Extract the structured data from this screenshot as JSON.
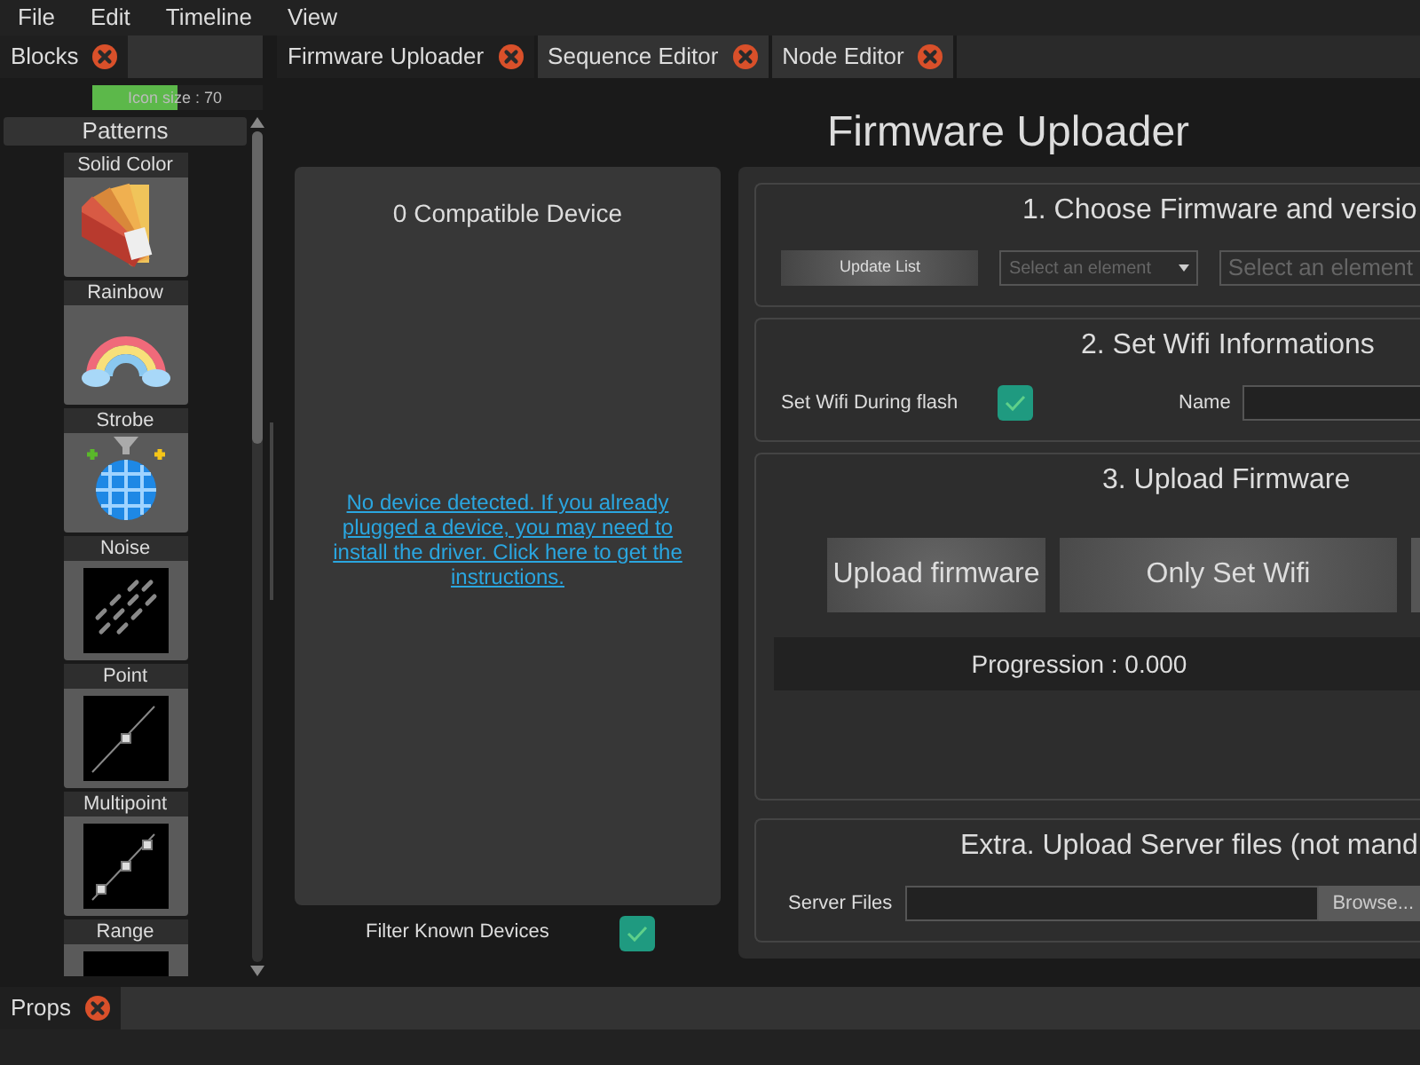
{
  "menu": [
    {
      "label": "File"
    },
    {
      "label": "Edit"
    },
    {
      "label": "Timeline"
    },
    {
      "label": "View"
    }
  ],
  "left_panel": {
    "tab": {
      "label": "Blocks",
      "selected": true
    },
    "icon_size": {
      "label": "Icon size : 70",
      "level": 0.5
    },
    "section": "Patterns",
    "blocks": [
      {
        "label": "Solid Color",
        "kind": "swatch"
      },
      {
        "label": "Rainbow",
        "kind": "rainbow"
      },
      {
        "label": "Strobe",
        "kind": "discoball"
      },
      {
        "label": "Noise",
        "kind": "noise"
      },
      {
        "label": "Point",
        "kind": "point"
      },
      {
        "label": "Multipoint",
        "kind": "multipoint"
      },
      {
        "label": "Range",
        "kind": "range"
      }
    ]
  },
  "tabs": [
    {
      "label": "Firmware Uploader",
      "selected": true
    },
    {
      "label": "Sequence Editor",
      "selected": false
    },
    {
      "label": "Node Editor",
      "selected": false
    }
  ],
  "title": "Firmware Uploader",
  "devices": {
    "heading": "0 Compatible Device",
    "message": "No device detected. If you already plugged a device, you may need to install the driver. Click here to get the instructions.",
    "filter": {
      "label": "Filter Known Devices",
      "checked": true
    }
  },
  "step1": {
    "title": "1. Choose Firmware and versio",
    "button": "Update List",
    "selects": [
      {
        "placeholder": "Select an element"
      },
      {
        "placeholder": "Select an element"
      }
    ]
  },
  "step2": {
    "title": "2. Set Wifi Informations",
    "wifi_during_flash": {
      "label": "Set Wifi During flash",
      "checked": true
    },
    "name_label": "Name"
  },
  "step3": {
    "title": "3. Upload Firmware",
    "buttons": [
      "Upload firmware",
      "Only Set Wifi"
    ],
    "progress": {
      "label": "Progression : 0.000"
    }
  },
  "extra": {
    "title": "Extra. Upload Server files (not mand",
    "field_label": "Server Files",
    "browse": "Browse..."
  },
  "bottom_panel": {
    "tab": {
      "label": "Props",
      "selected": true
    }
  }
}
